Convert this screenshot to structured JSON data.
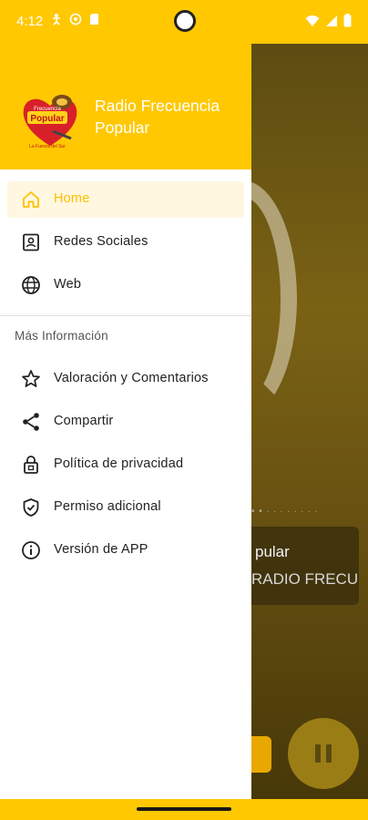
{
  "status_bar": {
    "time": "4:12"
  },
  "background_app": {
    "title_fragment": "pular",
    "subtitle_fragment": "RADIO FRECU"
  },
  "drawer": {
    "app_name": "Radio Frecuencia Popular",
    "logo": {
      "top_text": "Frecuencia",
      "main_text": "Popular",
      "tagline": "La Fuerza del Sur"
    },
    "accent_color": "#ffc800",
    "primary_items": [
      {
        "label": "Home",
        "icon": "home-icon",
        "active": true
      },
      {
        "label": "Redes Sociales",
        "icon": "contact-card-icon",
        "active": false
      },
      {
        "label": "Web",
        "icon": "globe-icon",
        "active": false
      }
    ],
    "section_title": "Más Información",
    "secondary_items": [
      {
        "label": "Valoración y Comentarios",
        "icon": "star-icon"
      },
      {
        "label": "Compartir",
        "icon": "share-icon"
      },
      {
        "label": "Política de privacidad",
        "icon": "lock-icon"
      },
      {
        "label": "Permiso adicional",
        "icon": "shield-check-icon"
      },
      {
        "label": "Versión de APP",
        "icon": "info-icon"
      }
    ]
  }
}
